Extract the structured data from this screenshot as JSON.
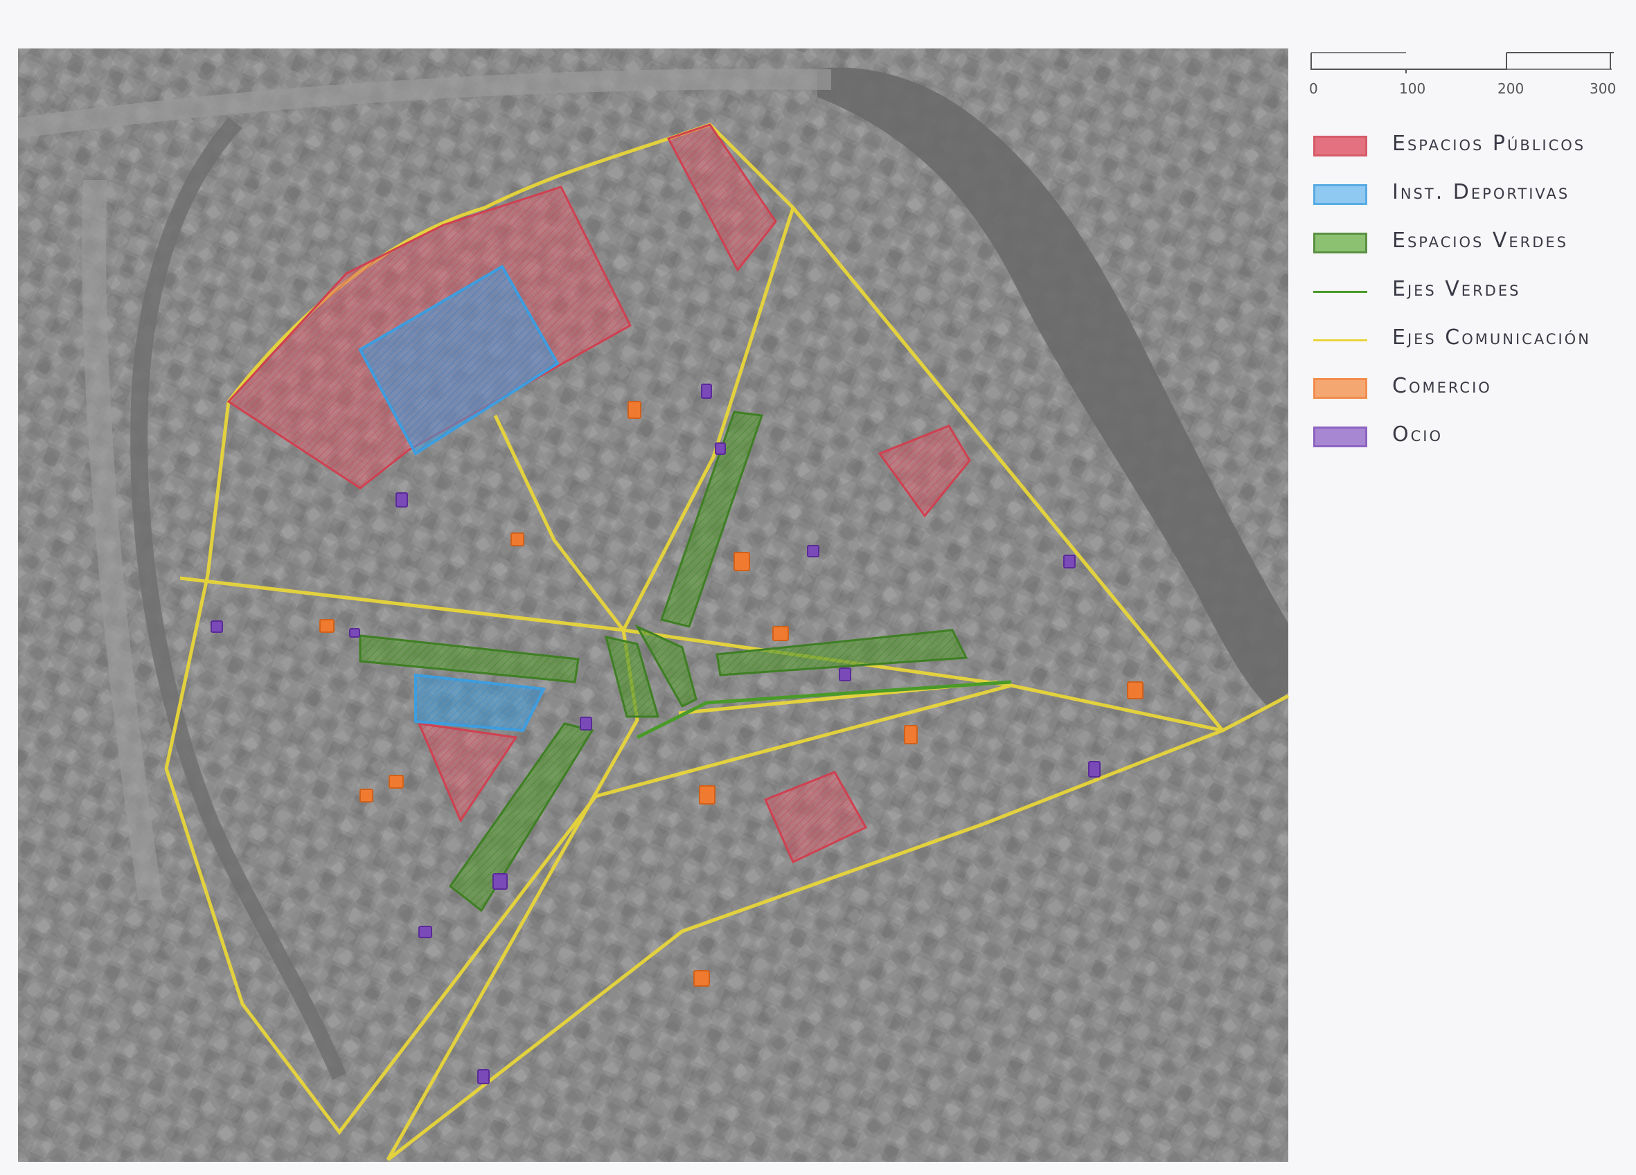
{
  "scale": {
    "ticks": [
      "0",
      "100",
      "200",
      "300"
    ]
  },
  "legend": {
    "items": [
      {
        "label": "Espacios Públicos",
        "kind": "area",
        "color": "#e05a6a"
      },
      {
        "label": "Inst. Deportivas",
        "kind": "area",
        "color": "#3d9ee0"
      },
      {
        "label": "Espacios Verdes",
        "kind": "area",
        "color": "#5a9a3a"
      },
      {
        "label": "Ejes Verdes",
        "kind": "line",
        "color": "#4a9a2a"
      },
      {
        "label": "Ejes Comunicación",
        "kind": "line",
        "color": "#e8d63a"
      },
      {
        "label": "Comercio",
        "kind": "area",
        "color": "#f07a30"
      },
      {
        "label": "Ocio",
        "kind": "area",
        "color": "#7a4ab8"
      }
    ]
  },
  "colors": {
    "public": "#e05a6a",
    "sports": "#3d9ee0",
    "green": "#5a9a3a",
    "green_axis": "#4a9a2a",
    "comm_axis": "#e8d63a",
    "commerce": "#f07a30",
    "leisure": "#7a4ab8",
    "aerial_base": "#8c8c8c"
  }
}
